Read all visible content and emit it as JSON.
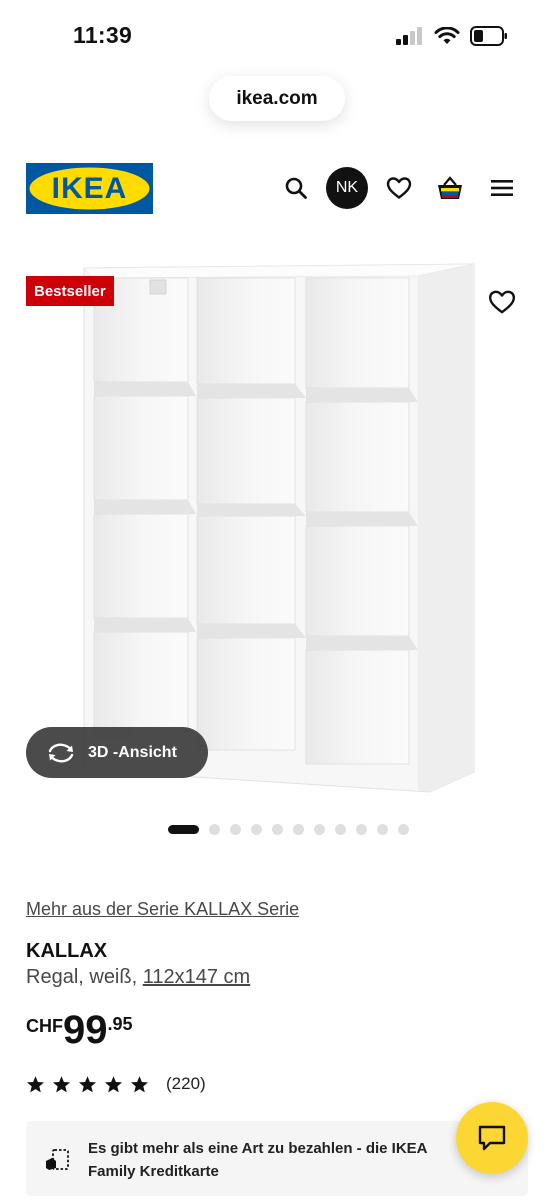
{
  "status_bar": {
    "time": "11:39"
  },
  "browser": {
    "url": "ikea.com"
  },
  "header": {
    "logo_text": "IKEA",
    "avatar_initials": "NK",
    "brand_blue": "#0058a3",
    "brand_yellow": "#ffdb00"
  },
  "product_image": {
    "badge": "Bestseller",
    "badge_color": "#cc0008",
    "view_3d_label": "3D -Ansicht",
    "image_count": 11,
    "active_index": 0
  },
  "product": {
    "series_link": "Mehr aus der Serie KALLAX Serie",
    "name": "KALLAX",
    "description_prefix": "Regal, weiß, ",
    "dimensions": "112x147 cm",
    "price_currency": "CHF",
    "price_integer": "99",
    "price_decimal": ".95",
    "rating_stars": 5,
    "review_count": "(220)"
  },
  "payment_info": {
    "text": "Es gibt mehr als eine Art zu bezahlen - die IKEA Family Kreditkarte"
  },
  "chat": {
    "color": "#fcd733"
  }
}
